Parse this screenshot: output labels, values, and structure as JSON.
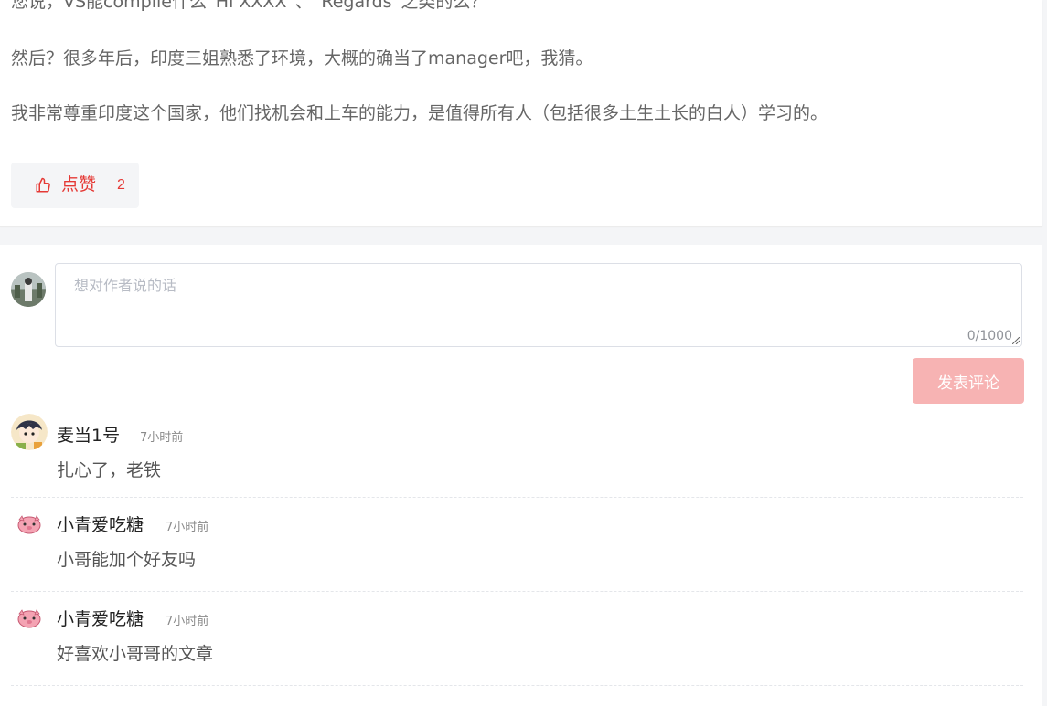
{
  "article": {
    "paragraphs": [
      "您说，VS能compile什么“Hi XXXX”、“Regards”之类的么？",
      "然后？很多年后，印度三姐熟悉了环境，大概的确当了manager吧，我猜。",
      "我非常尊重印度这个国家，他们找机会和上车的能力，是值得所有人（包括很多土生土长的白人）学习的。"
    ],
    "like": {
      "icon": "thumbs-up-icon",
      "label": "点赞",
      "count": "2"
    }
  },
  "comment_form": {
    "placeholder": "想对作者说的话",
    "value": "",
    "char_count": "0/1000",
    "submit_label": "发表评论",
    "submit_color": "#f7b3b3"
  },
  "comments": [
    {
      "author": "麦当1号",
      "time": "7小时前",
      "text": "扎心了，老铁"
    },
    {
      "author": "小青爱吃糖",
      "time": "7小时前",
      "text": "小哥能加个好友吗"
    },
    {
      "author": "小青爱吃糖",
      "time": "7小时前",
      "text": "好喜欢小哥哥的文章"
    }
  ],
  "colors": {
    "accent_red": "#e53935",
    "page_bg": "#f4f5f7"
  }
}
